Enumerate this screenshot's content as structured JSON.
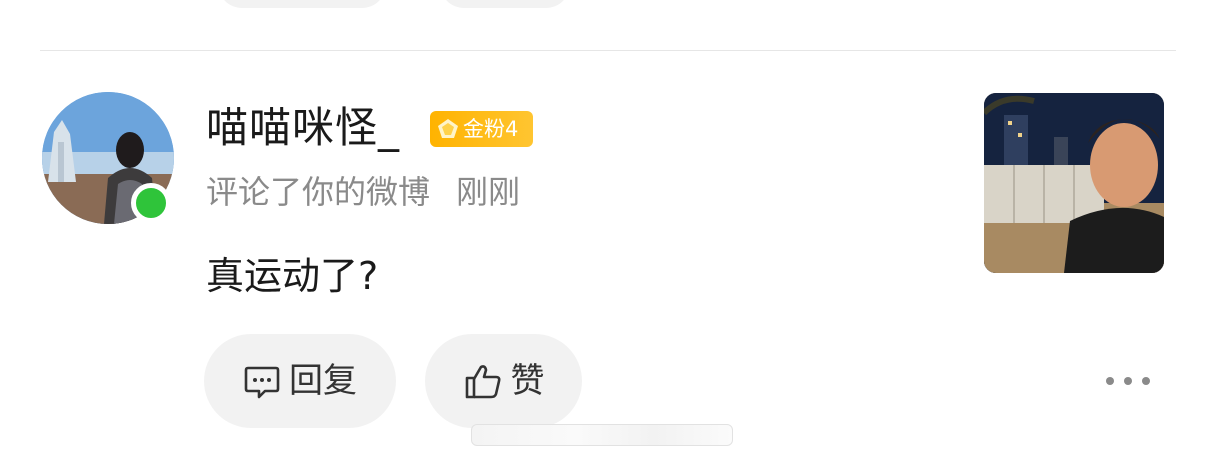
{
  "notification": {
    "username": "喵喵咪怪_",
    "fan_badge": "金粉4",
    "action_text": "评论了你的微博",
    "time": "刚刚",
    "comment": "真运动了?",
    "reply_label": "回复",
    "like_label": "赞"
  },
  "icons": {
    "badge": "gold-gem-icon",
    "reply": "comment-bubble-icon",
    "like": "thumbs-up-icon",
    "more": "more-dots-icon"
  },
  "colors": {
    "online": "#2fc43a",
    "badge": "#ffb300",
    "secondary_text": "#8a8a8a",
    "pill_bg": "#f2f2f2"
  }
}
